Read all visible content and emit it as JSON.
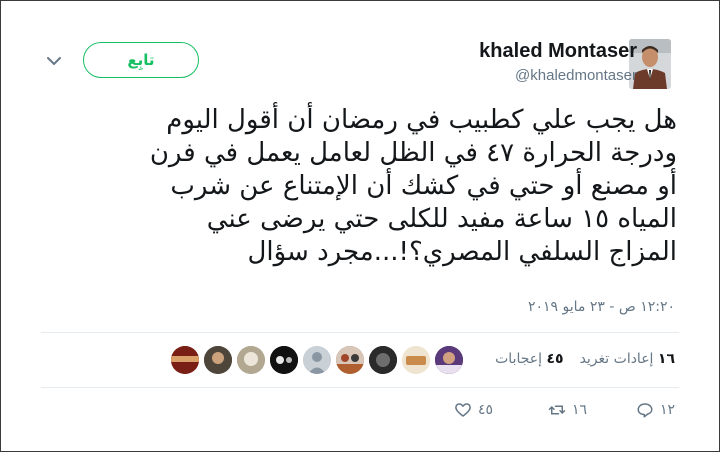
{
  "tweet": {
    "display_name": "khaled Montaser",
    "handle": "@khaledmontaser",
    "follow_label": "تابِع",
    "text_lines": [
      "هل يجب علي كطبيب في رمضان أن أقول اليوم",
      "ودرجة الحرارة ٤٧ في الظل لعامل يعمل في فرن",
      "أو مصنع أو حتي في كشك أن الإمتناع عن شرب",
      "المياه ١٥ ساعة مفيد للكلى حتي يرضى عني",
      "المزاج السلفي المصري؟!...مجرد سؤال"
    ],
    "timestamp": "١٢:٢٠ ص - ٢٣ مايو ٢٠١٩",
    "stats": {
      "retweets_count": "١٦",
      "retweets_label": "إعادات تغريد",
      "likes_count": "٤٥",
      "likes_label": "إعجابات"
    },
    "actions": {
      "reply_count": "١٢",
      "retweet_count": "١٦",
      "like_count": "٤٥"
    }
  },
  "icons": [
    "chevron-down-icon",
    "reply-icon",
    "retweet-icon",
    "heart-icon"
  ],
  "colors": {
    "follow_green": "#17bf63",
    "secondary_text": "#657786",
    "primary_text": "#14171a"
  }
}
